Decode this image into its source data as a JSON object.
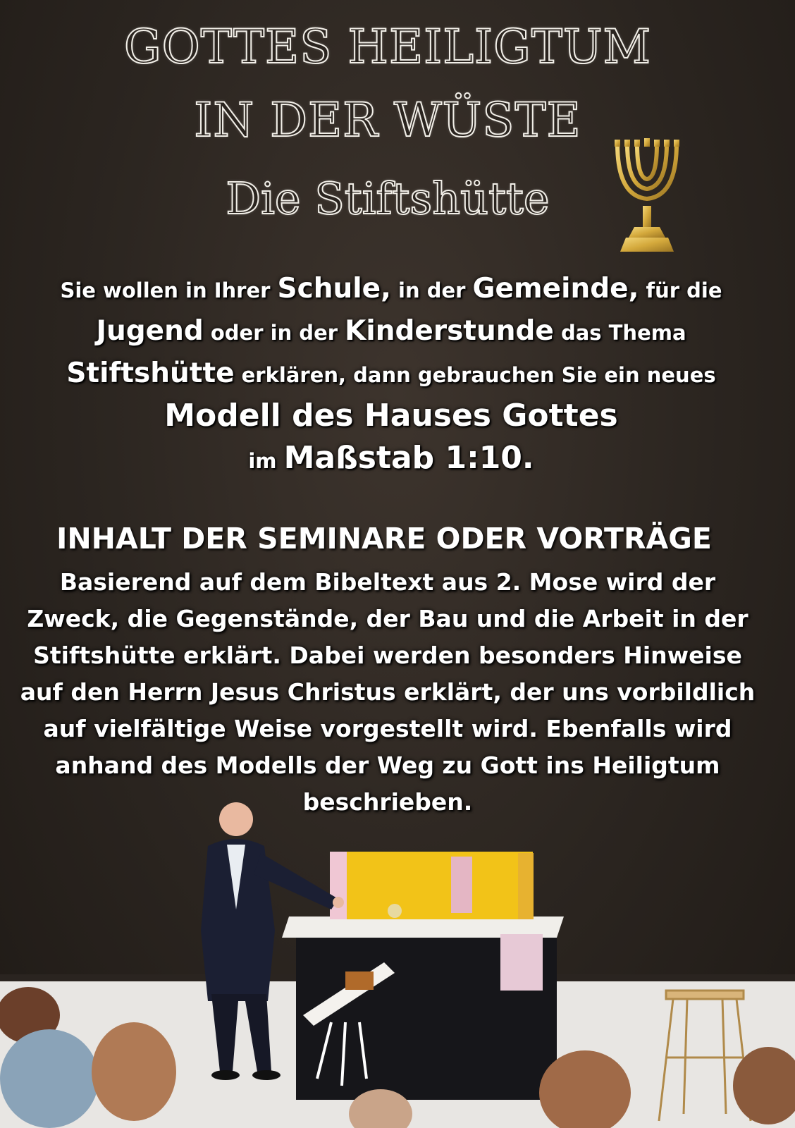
{
  "title": {
    "line1": "GOTTES HEILIGTUM",
    "line2": "IN DER WÜSTE",
    "line3": "Die Stiftshütte"
  },
  "intro": {
    "l1a": "Sie wollen in Ihrer ",
    "l1b": "Schule,",
    "l1c": " in der ",
    "l1d": "Gemeinde,",
    "l1e": " für die",
    "l2a": "Jugend",
    "l2b": " oder in der ",
    "l2c": "Kinderstunde",
    "l2d": " das Thema",
    "l3a": "Stiftshütte",
    "l3b": " erklären, dann gebrauchen Sie ein neues",
    "l4": "Modell des Hauses Gottes",
    "l5a": "im ",
    "l5b": "Maßstab 1:10."
  },
  "section": {
    "heading": "INHALT DER SEMINARE ODER VORTRÄGE",
    "body": "Basierend auf dem Bibeltext aus 2. Mose wird der Zweck, die Gegenstände, der Bau und die Arbeit in der Stiftshütte erklärt. Dabei werden besonders Hinweise auf den Herrn Jesus Christus erklärt, der uns vorbildlich auf vielfältige Weise vorgestellt wird. Ebenfalls wird anhand des Modells der Weg zu Gott ins Heiligtum beschrieben."
  },
  "icons": {
    "menorah": "menorah-icon"
  },
  "colors": {
    "background": "#2b2520",
    "gold": "#d4a93c",
    "model_yellow": "#f2c318"
  }
}
